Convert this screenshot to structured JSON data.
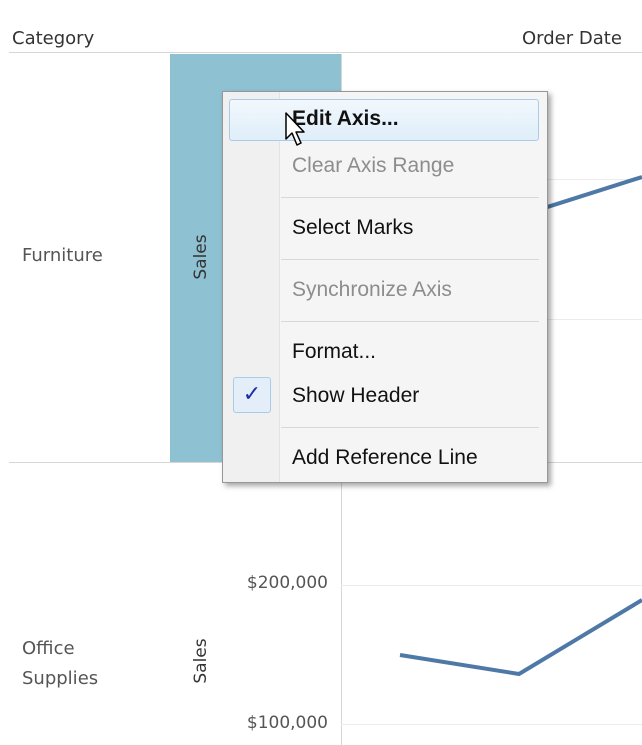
{
  "header": {
    "category_label": "Category",
    "order_date_label": "Order Date"
  },
  "rows": [
    {
      "category": "Furniture",
      "axis_label": "Sales"
    },
    {
      "category": "Office\nSupplies",
      "axis_label": "Sales",
      "ticks": [
        "$200,000",
        "$100,000"
      ]
    }
  ],
  "context_menu": {
    "items": [
      {
        "label": "Edit Axis...",
        "enabled": true,
        "hovered": true
      },
      {
        "label": "Clear Axis Range",
        "enabled": false
      },
      {
        "label": "Select Marks",
        "enabled": true
      },
      {
        "label": "Synchronize Axis",
        "enabled": false
      },
      {
        "label": "Format...",
        "enabled": true
      },
      {
        "label": "Show Header",
        "enabled": true,
        "checked": true
      },
      {
        "label": "Add Reference Line",
        "enabled": true
      }
    ],
    "check_glyph": "✓"
  },
  "colors": {
    "axis_highlight": "#8ec1d2",
    "line": "#4e79a7",
    "check": "#1a2fa0"
  },
  "icons": {
    "cursor": "mouse-pointer-icon",
    "check": "checkmark-icon"
  }
}
